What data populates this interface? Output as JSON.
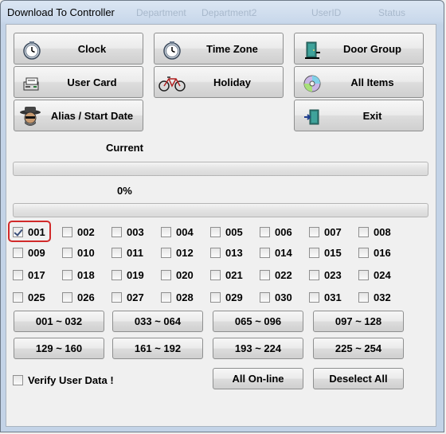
{
  "window": {
    "title": "Download To Controller",
    "ghost_labels": [
      "Department",
      "Department2",
      "UserID",
      "Status"
    ]
  },
  "buttons": {
    "clock": "Clock",
    "time_zone": "Time Zone",
    "door_group": "Door Group",
    "user_card": "User Card",
    "holiday": "Holiday",
    "all_items": "All Items",
    "alias_start_date": "Alias / Start Date",
    "exit": "Exit"
  },
  "progress": {
    "current_label": "Current",
    "current_value": 0,
    "overall_label": "0%",
    "overall_value": 0
  },
  "controllers": [
    {
      "label": "001",
      "checked": true
    },
    {
      "label": "002",
      "checked": false
    },
    {
      "label": "003",
      "checked": false
    },
    {
      "label": "004",
      "checked": false
    },
    {
      "label": "005",
      "checked": false
    },
    {
      "label": "006",
      "checked": false
    },
    {
      "label": "007",
      "checked": false
    },
    {
      "label": "008",
      "checked": false
    },
    {
      "label": "009",
      "checked": false
    },
    {
      "label": "010",
      "checked": false
    },
    {
      "label": "011",
      "checked": false
    },
    {
      "label": "012",
      "checked": false
    },
    {
      "label": "013",
      "checked": false
    },
    {
      "label": "014",
      "checked": false
    },
    {
      "label": "015",
      "checked": false
    },
    {
      "label": "016",
      "checked": false
    },
    {
      "label": "017",
      "checked": false
    },
    {
      "label": "018",
      "checked": false
    },
    {
      "label": "019",
      "checked": false
    },
    {
      "label": "020",
      "checked": false
    },
    {
      "label": "021",
      "checked": false
    },
    {
      "label": "022",
      "checked": false
    },
    {
      "label": "023",
      "checked": false
    },
    {
      "label": "024",
      "checked": false
    },
    {
      "label": "025",
      "checked": false
    },
    {
      "label": "026",
      "checked": false
    },
    {
      "label": "027",
      "checked": false
    },
    {
      "label": "028",
      "checked": false
    },
    {
      "label": "029",
      "checked": false
    },
    {
      "label": "030",
      "checked": false
    },
    {
      "label": "031",
      "checked": false
    },
    {
      "label": "032",
      "checked": false
    }
  ],
  "ranges": [
    "001 ~ 032",
    "033 ~ 064",
    "065 ~ 096",
    "097 ~ 128",
    "129 ~ 160",
    "161 ~ 192",
    "193 ~ 224",
    "225 ~ 254"
  ],
  "verify": {
    "label": "Verify User Data !",
    "checked": false
  },
  "bottom": {
    "all_online": "All On-line",
    "deselect_all": "Deselect All"
  }
}
